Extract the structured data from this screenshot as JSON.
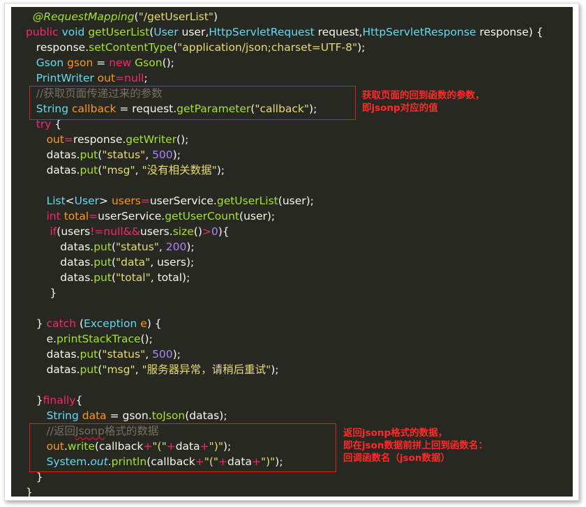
{
  "code": {
    "lines": [
      [
        {
          "t": "  "
        },
        {
          "t": "@RequestMapping",
          "c": "an"
        },
        {
          "t": "(",
          "c": "tx"
        },
        {
          "t": "\"/getUserList\"",
          "c": "st"
        },
        {
          "t": ")",
          "c": "tx"
        }
      ],
      [
        {
          "t": "public ",
          "c": "kw"
        },
        {
          "t": "void ",
          "c": "ty"
        },
        {
          "t": "getUserList",
          "c": "fn"
        },
        {
          "t": "(",
          "c": "tx"
        },
        {
          "t": "User ",
          "c": "ty"
        },
        {
          "t": "user,",
          "c": "tx"
        },
        {
          "t": "HttpServletRequest ",
          "c": "ty"
        },
        {
          "t": "request,",
          "c": "tx"
        },
        {
          "t": "HttpServletResponse ",
          "c": "ty"
        },
        {
          "t": "response) {",
          "c": "tx"
        }
      ],
      [
        {
          "t": "   "
        },
        {
          "t": "response",
          "c": "tx"
        },
        {
          "t": ".",
          "c": "tx"
        },
        {
          "t": "setContentType",
          "c": "fn"
        },
        {
          "t": "(",
          "c": "tx"
        },
        {
          "t": "\"application/json;charset=UTF-8\"",
          "c": "st"
        },
        {
          "t": ");",
          "c": "tx"
        }
      ],
      [
        {
          "t": "   "
        },
        {
          "t": "Gson ",
          "c": "ty"
        },
        {
          "t": "gson ",
          "c": "vr"
        },
        {
          "t": "= ",
          "c": "tx"
        },
        {
          "t": "new ",
          "c": "kw"
        },
        {
          "t": "Gson",
          "c": "fn"
        },
        {
          "t": "();",
          "c": "tx"
        }
      ],
      [
        {
          "t": "   "
        },
        {
          "t": "PrintWriter ",
          "c": "ty"
        },
        {
          "t": "out",
          "c": "vr"
        },
        {
          "t": "=",
          "c": "kw"
        },
        {
          "t": "null",
          "c": "kw"
        },
        {
          "t": ";",
          "c": "tx"
        }
      ],
      [
        {
          "t": "   "
        },
        {
          "t": "//获取页面传递过来的参数",
          "c": "cm"
        }
      ],
      [
        {
          "t": "   "
        },
        {
          "t": "String ",
          "c": "ty"
        },
        {
          "t": "callback ",
          "c": "vr"
        },
        {
          "t": "= ",
          "c": "tx"
        },
        {
          "t": "request",
          "c": "tx"
        },
        {
          "t": ".",
          "c": "tx"
        },
        {
          "t": "getParameter",
          "c": "fn"
        },
        {
          "t": "(",
          "c": "tx"
        },
        {
          "t": "\"callback\"",
          "c": "st"
        },
        {
          "t": ");",
          "c": "tx"
        }
      ],
      [
        {
          "t": "   "
        },
        {
          "t": "try ",
          "c": "kw"
        },
        {
          "t": "{",
          "c": "tx"
        }
      ],
      [
        {
          "t": "      "
        },
        {
          "t": "out",
          "c": "vr"
        },
        {
          "t": "=",
          "c": "kw"
        },
        {
          "t": "response",
          "c": "tx"
        },
        {
          "t": ".",
          "c": "tx"
        },
        {
          "t": "getWriter",
          "c": "fn"
        },
        {
          "t": "();",
          "c": "tx"
        }
      ],
      [
        {
          "t": "      "
        },
        {
          "t": "datas",
          "c": "tx"
        },
        {
          "t": ".",
          "c": "tx"
        },
        {
          "t": "put",
          "c": "fn"
        },
        {
          "t": "(",
          "c": "tx"
        },
        {
          "t": "\"status\"",
          "c": "st"
        },
        {
          "t": ", ",
          "c": "tx"
        },
        {
          "t": "500",
          "c": "nu"
        },
        {
          "t": ");",
          "c": "tx"
        }
      ],
      [
        {
          "t": "      "
        },
        {
          "t": "datas",
          "c": "tx"
        },
        {
          "t": ".",
          "c": "tx"
        },
        {
          "t": "put",
          "c": "fn"
        },
        {
          "t": "(",
          "c": "tx"
        },
        {
          "t": "\"msg\"",
          "c": "st"
        },
        {
          "t": ", ",
          "c": "tx"
        },
        {
          "t": "\"没有相关数据\"",
          "c": "st"
        },
        {
          "t": ");",
          "c": "tx"
        }
      ],
      [],
      [
        {
          "t": "      "
        },
        {
          "t": "List",
          "c": "ty"
        },
        {
          "t": "<",
          "c": "tx"
        },
        {
          "t": "User",
          "c": "ty"
        },
        {
          "t": "> ",
          "c": "tx"
        },
        {
          "t": "users",
          "c": "vr"
        },
        {
          "t": "=",
          "c": "kw"
        },
        {
          "t": "userService",
          "c": "tx"
        },
        {
          "t": ".",
          "c": "tx"
        },
        {
          "t": "getUserList",
          "c": "fn"
        },
        {
          "t": "(",
          "c": "tx"
        },
        {
          "t": "user",
          "c": "tx"
        },
        {
          "t": ");",
          "c": "tx"
        }
      ],
      [
        {
          "t": "      "
        },
        {
          "t": "int ",
          "c": "kw"
        },
        {
          "t": "total",
          "c": "vr"
        },
        {
          "t": "=",
          "c": "kw"
        },
        {
          "t": "userService",
          "c": "tx"
        },
        {
          "t": ".",
          "c": "tx"
        },
        {
          "t": "getUserCount",
          "c": "fn"
        },
        {
          "t": "(",
          "c": "tx"
        },
        {
          "t": "user",
          "c": "tx"
        },
        {
          "t": ");",
          "c": "tx"
        }
      ],
      [
        {
          "t": "       "
        },
        {
          "t": "if",
          "c": "kw"
        },
        {
          "t": "(",
          "c": "tx"
        },
        {
          "t": "users",
          "c": "tx"
        },
        {
          "t": "!=",
          "c": "kw"
        },
        {
          "t": "null",
          "c": "kw"
        },
        {
          "t": "&&",
          "c": "kw"
        },
        {
          "t": "users",
          "c": "tx"
        },
        {
          "t": ".",
          "c": "tx"
        },
        {
          "t": "size",
          "c": "fn"
        },
        {
          "t": "()",
          "c": "tx"
        },
        {
          "t": ">",
          "c": "kw"
        },
        {
          "t": "0",
          "c": "nu"
        },
        {
          "t": "){",
          "c": "tx"
        }
      ],
      [
        {
          "t": "          "
        },
        {
          "t": "datas",
          "c": "tx"
        },
        {
          "t": ".",
          "c": "tx"
        },
        {
          "t": "put",
          "c": "fn"
        },
        {
          "t": "(",
          "c": "tx"
        },
        {
          "t": "\"status\"",
          "c": "st"
        },
        {
          "t": ", ",
          "c": "tx"
        },
        {
          "t": "200",
          "c": "nu"
        },
        {
          "t": ");",
          "c": "tx"
        }
      ],
      [
        {
          "t": "          "
        },
        {
          "t": "datas",
          "c": "tx"
        },
        {
          "t": ".",
          "c": "tx"
        },
        {
          "t": "put",
          "c": "fn"
        },
        {
          "t": "(",
          "c": "tx"
        },
        {
          "t": "\"data\"",
          "c": "st"
        },
        {
          "t": ", ",
          "c": "tx"
        },
        {
          "t": "users",
          "c": "tx"
        },
        {
          "t": ");",
          "c": "tx"
        }
      ],
      [
        {
          "t": "          "
        },
        {
          "t": "datas",
          "c": "tx"
        },
        {
          "t": ".",
          "c": "tx"
        },
        {
          "t": "put",
          "c": "fn"
        },
        {
          "t": "(",
          "c": "tx"
        },
        {
          "t": "\"total\"",
          "c": "st"
        },
        {
          "t": ", ",
          "c": "tx"
        },
        {
          "t": "total",
          "c": "tx"
        },
        {
          "t": ");",
          "c": "tx"
        }
      ],
      [
        {
          "t": "       "
        },
        {
          "t": "}",
          "c": "tx"
        }
      ],
      [],
      [
        {
          "t": "   "
        },
        {
          "t": "} ",
          "c": "tx"
        },
        {
          "t": "catch ",
          "c": "kw"
        },
        {
          "t": "(",
          "c": "tx"
        },
        {
          "t": "Exception ",
          "c": "ty"
        },
        {
          "t": "e",
          "c": "vr"
        },
        {
          "t": ") {",
          "c": "tx"
        }
      ],
      [
        {
          "t": "      "
        },
        {
          "t": "e",
          "c": "tx"
        },
        {
          "t": ".",
          "c": "tx"
        },
        {
          "t": "printStackTrace",
          "c": "fn"
        },
        {
          "t": "();",
          "c": "tx"
        }
      ],
      [
        {
          "t": "      "
        },
        {
          "t": "datas",
          "c": "tx"
        },
        {
          "t": ".",
          "c": "tx"
        },
        {
          "t": "put",
          "c": "fn"
        },
        {
          "t": "(",
          "c": "tx"
        },
        {
          "t": "\"status\"",
          "c": "st"
        },
        {
          "t": ", ",
          "c": "tx"
        },
        {
          "t": "500",
          "c": "nu"
        },
        {
          "t": ");",
          "c": "tx"
        }
      ],
      [
        {
          "t": "      "
        },
        {
          "t": "datas",
          "c": "tx"
        },
        {
          "t": ".",
          "c": "tx"
        },
        {
          "t": "put",
          "c": "fn"
        },
        {
          "t": "(",
          "c": "tx"
        },
        {
          "t": "\"msg\"",
          "c": "st"
        },
        {
          "t": ", ",
          "c": "tx"
        },
        {
          "t": "\"服务器异常，请稍后重试\"",
          "c": "st"
        },
        {
          "t": ");",
          "c": "tx"
        }
      ],
      [],
      [
        {
          "t": "   "
        },
        {
          "t": "}",
          "c": "tx"
        },
        {
          "t": "finally",
          "c": "kw"
        },
        {
          "t": "{",
          "c": "tx"
        }
      ],
      [
        {
          "t": "      "
        },
        {
          "t": "String ",
          "c": "ty"
        },
        {
          "t": "data ",
          "c": "vr"
        },
        {
          "t": "= ",
          "c": "tx"
        },
        {
          "t": "gson",
          "c": "tx"
        },
        {
          "t": ".",
          "c": "tx"
        },
        {
          "t": "toJson",
          "c": "fn"
        },
        {
          "t": "(",
          "c": "tx"
        },
        {
          "t": "datas",
          "c": "tx"
        },
        {
          "t": ");",
          "c": "tx"
        }
      ],
      [
        {
          "t": "      "
        },
        {
          "t": "//返回",
          "c": "cm"
        },
        {
          "t": "Jsonp",
          "c": "cm",
          "u": true
        },
        {
          "t": "格式的数据",
          "c": "cm"
        }
      ],
      [
        {
          "t": "      "
        },
        {
          "t": "out",
          "c": "vr"
        },
        {
          "t": ".",
          "c": "tx"
        },
        {
          "t": "write",
          "c": "fn"
        },
        {
          "t": "(",
          "c": "tx"
        },
        {
          "t": "callback",
          "c": "tx"
        },
        {
          "t": "+",
          "c": "kw"
        },
        {
          "t": "\"(\"",
          "c": "st"
        },
        {
          "t": "+",
          "c": "kw"
        },
        {
          "t": "data",
          "c": "tx"
        },
        {
          "t": "+",
          "c": "kw"
        },
        {
          "t": "\")\"",
          "c": "st"
        },
        {
          "t": ");",
          "c": "tx"
        }
      ],
      [
        {
          "t": "      "
        },
        {
          "t": "System",
          "c": "ty"
        },
        {
          "t": ".",
          "c": "tx"
        },
        {
          "t": "out",
          "c": "ty",
          "i": true
        },
        {
          "t": ".",
          "c": "tx"
        },
        {
          "t": "println",
          "c": "fn"
        },
        {
          "t": "(",
          "c": "tx"
        },
        {
          "t": "callback",
          "c": "tx"
        },
        {
          "t": "+",
          "c": "kw"
        },
        {
          "t": "\"(\"",
          "c": "st"
        },
        {
          "t": "+",
          "c": "kw"
        },
        {
          "t": "data",
          "c": "tx"
        },
        {
          "t": "+",
          "c": "kw"
        },
        {
          "t": "\")\"",
          "c": "st"
        },
        {
          "t": ");",
          "c": "tx"
        }
      ],
      [
        {
          "t": "   "
        },
        {
          "t": "}",
          "c": "tx"
        }
      ],
      [
        {
          "t": "}",
          "c": "tx"
        }
      ]
    ]
  },
  "annotations": {
    "note1": "获取页面的回到函数的参数，\n即jsonp对应的值",
    "note2": "返回jsonp格式的数据，\n即在json数据前拼上回到函数名：\n回调函数名（json数据）"
  },
  "colors": {
    "background": "#272822",
    "keyword": "#f92672",
    "type": "#66d9ef",
    "function": "#a6e22e",
    "string": "#e6db74",
    "number": "#ae81ff",
    "comment": "#75715e",
    "annotation_red": "#e02020"
  }
}
